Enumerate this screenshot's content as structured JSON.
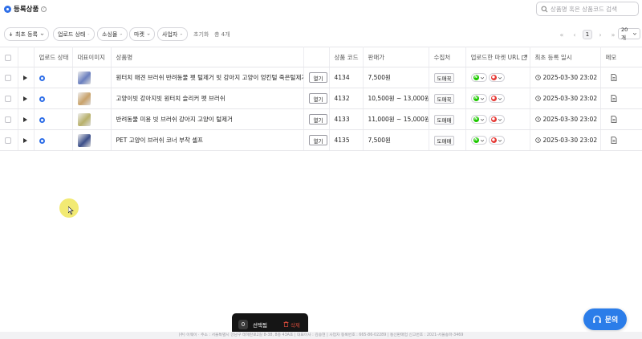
{
  "header": {
    "title": "등록상품",
    "search_placeholder": "상품명 혹은 상품코드 검색"
  },
  "filters": {
    "sort_label": "최초 등록",
    "upload_status_label": "업로드 상태",
    "sourcing_label": "소싱몰",
    "market_label": "마켓",
    "business_label": "사업자",
    "reset_label": "초기화",
    "total_label": "총 4개"
  },
  "pagination": {
    "current_page": "1",
    "per_page": "20개"
  },
  "table": {
    "columns": [
      "",
      "업로드 상태",
      "대표이미지",
      "상품명",
      "",
      "상품 코드",
      "판매가",
      "수집처",
      "업로드한 마켓 URL",
      "최초 등록 일시",
      "메모"
    ],
    "open_label": "열기",
    "rows": [
      {
        "name": "원터치 애견 브러쉬 반려동물 펫 털제거 빗 강아지 고양이 엉킨털 죽은털제거빗",
        "code": "4134",
        "price": "7,500원",
        "source": "도매꾹",
        "date": "2025-03-30 23:02",
        "thumb_color": "#6a7fbf"
      },
      {
        "name": "고양이빗 강아지빗 원터치 슬리커 펫 브러쉬",
        "code": "4132",
        "price": "10,500원 ~ 13,000원",
        "source": "도매꾹",
        "date": "2025-03-30 23:02",
        "thumb_color": "#c9a26a"
      },
      {
        "name": "반려동물 미용 빗 브러쉬 강아지 고양이 털제거",
        "code": "4133",
        "price": "11,000원 ~ 15,000원",
        "source": "도매매",
        "date": "2025-03-30 23:02",
        "thumb_color": "#b8b06a"
      },
      {
        "name": "PET 고양이 브러쉬 코너 부착 셀프",
        "code": "4135",
        "price": "7,500원",
        "source": "도매매",
        "date": "2025-03-30 23:02",
        "thumb_color": "#3c4f8a"
      }
    ],
    "market_a_color": "#1ec800",
    "market_b_color": "#e53935"
  },
  "selection": {
    "count": "0",
    "label": "선택됨",
    "delete_label": "삭제"
  },
  "inquiry_label": "문의",
  "footer_text": "(주) 이웨이 · 주소 : 서울특별시 강남구 테헤란로2길 8-38, 8층 43A호 | 대표이사 : 김승현 | 사업자 등록번호 : 665-86-02289 | 통신판매업 신고번호 : 2021-서울송파-3469"
}
